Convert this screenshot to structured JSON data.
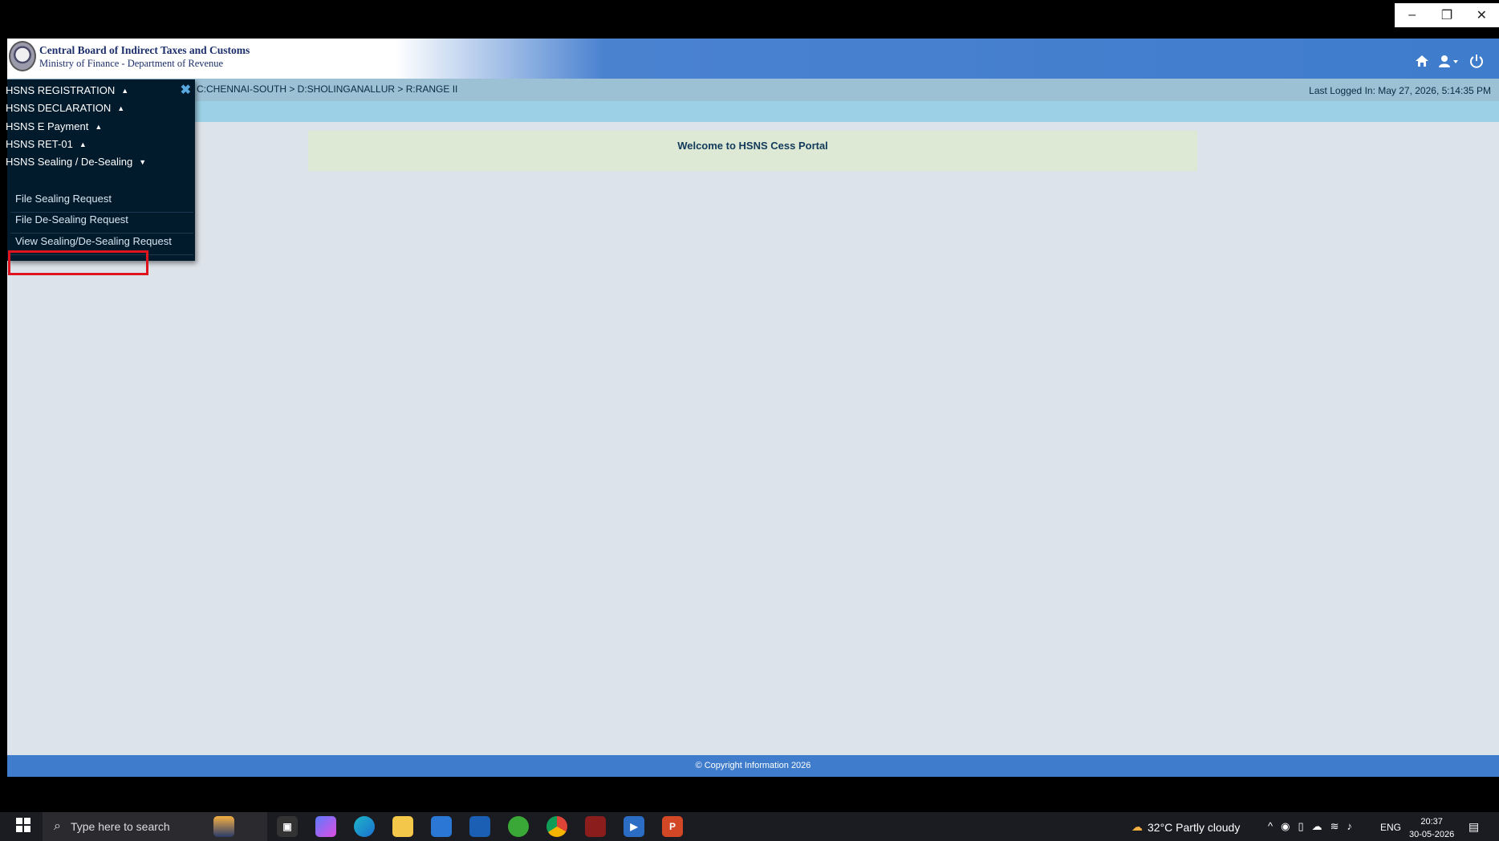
{
  "window": {
    "minimize": "–",
    "restore": "❐",
    "close": "✕"
  },
  "header": {
    "org_name": "Central Board of Indirect Taxes and Customs",
    "org_sub": "Ministry of Finance - Department of Revenue",
    "icons": [
      "home-icon",
      "user-icon",
      "power-icon"
    ]
  },
  "breadcrumb": "C:CHENNAI-SOUTH > D:SHOLINGANALLUR > R:RANGE II",
  "last_login": "Last Logged In: May 27, 2026, 5:14:35 PM",
  "welcome": "Welcome to HSNS Cess Portal",
  "sidebar": {
    "menus": [
      {
        "label": "HSNS REGISTRATION",
        "caret": "up"
      },
      {
        "label": "HSNS DECLARATION",
        "caret": "up"
      },
      {
        "label": "HSNS E Payment",
        "caret": "up"
      },
      {
        "label": "HSNS RET-01",
        "caret": "up"
      },
      {
        "label": "HSNS Sealing / De-Sealing",
        "caret": "down"
      }
    ],
    "submenu": [
      "File Sealing Request",
      "File De-Sealing Request",
      "View Sealing/De-Sealing Request"
    ],
    "highlighted": "File De-Sealing Request"
  },
  "footer": {
    "copyright": "© Copyright Information 2026"
  },
  "taskbar": {
    "search_placeholder": "Type here to search",
    "weather": "32°C  Partly cloudy",
    "lang": "ENG",
    "time": "20:37",
    "date": "30-05-2026",
    "colors": {
      "accent": "#3f7ccc",
      "highlight": "#e0141e"
    }
  }
}
